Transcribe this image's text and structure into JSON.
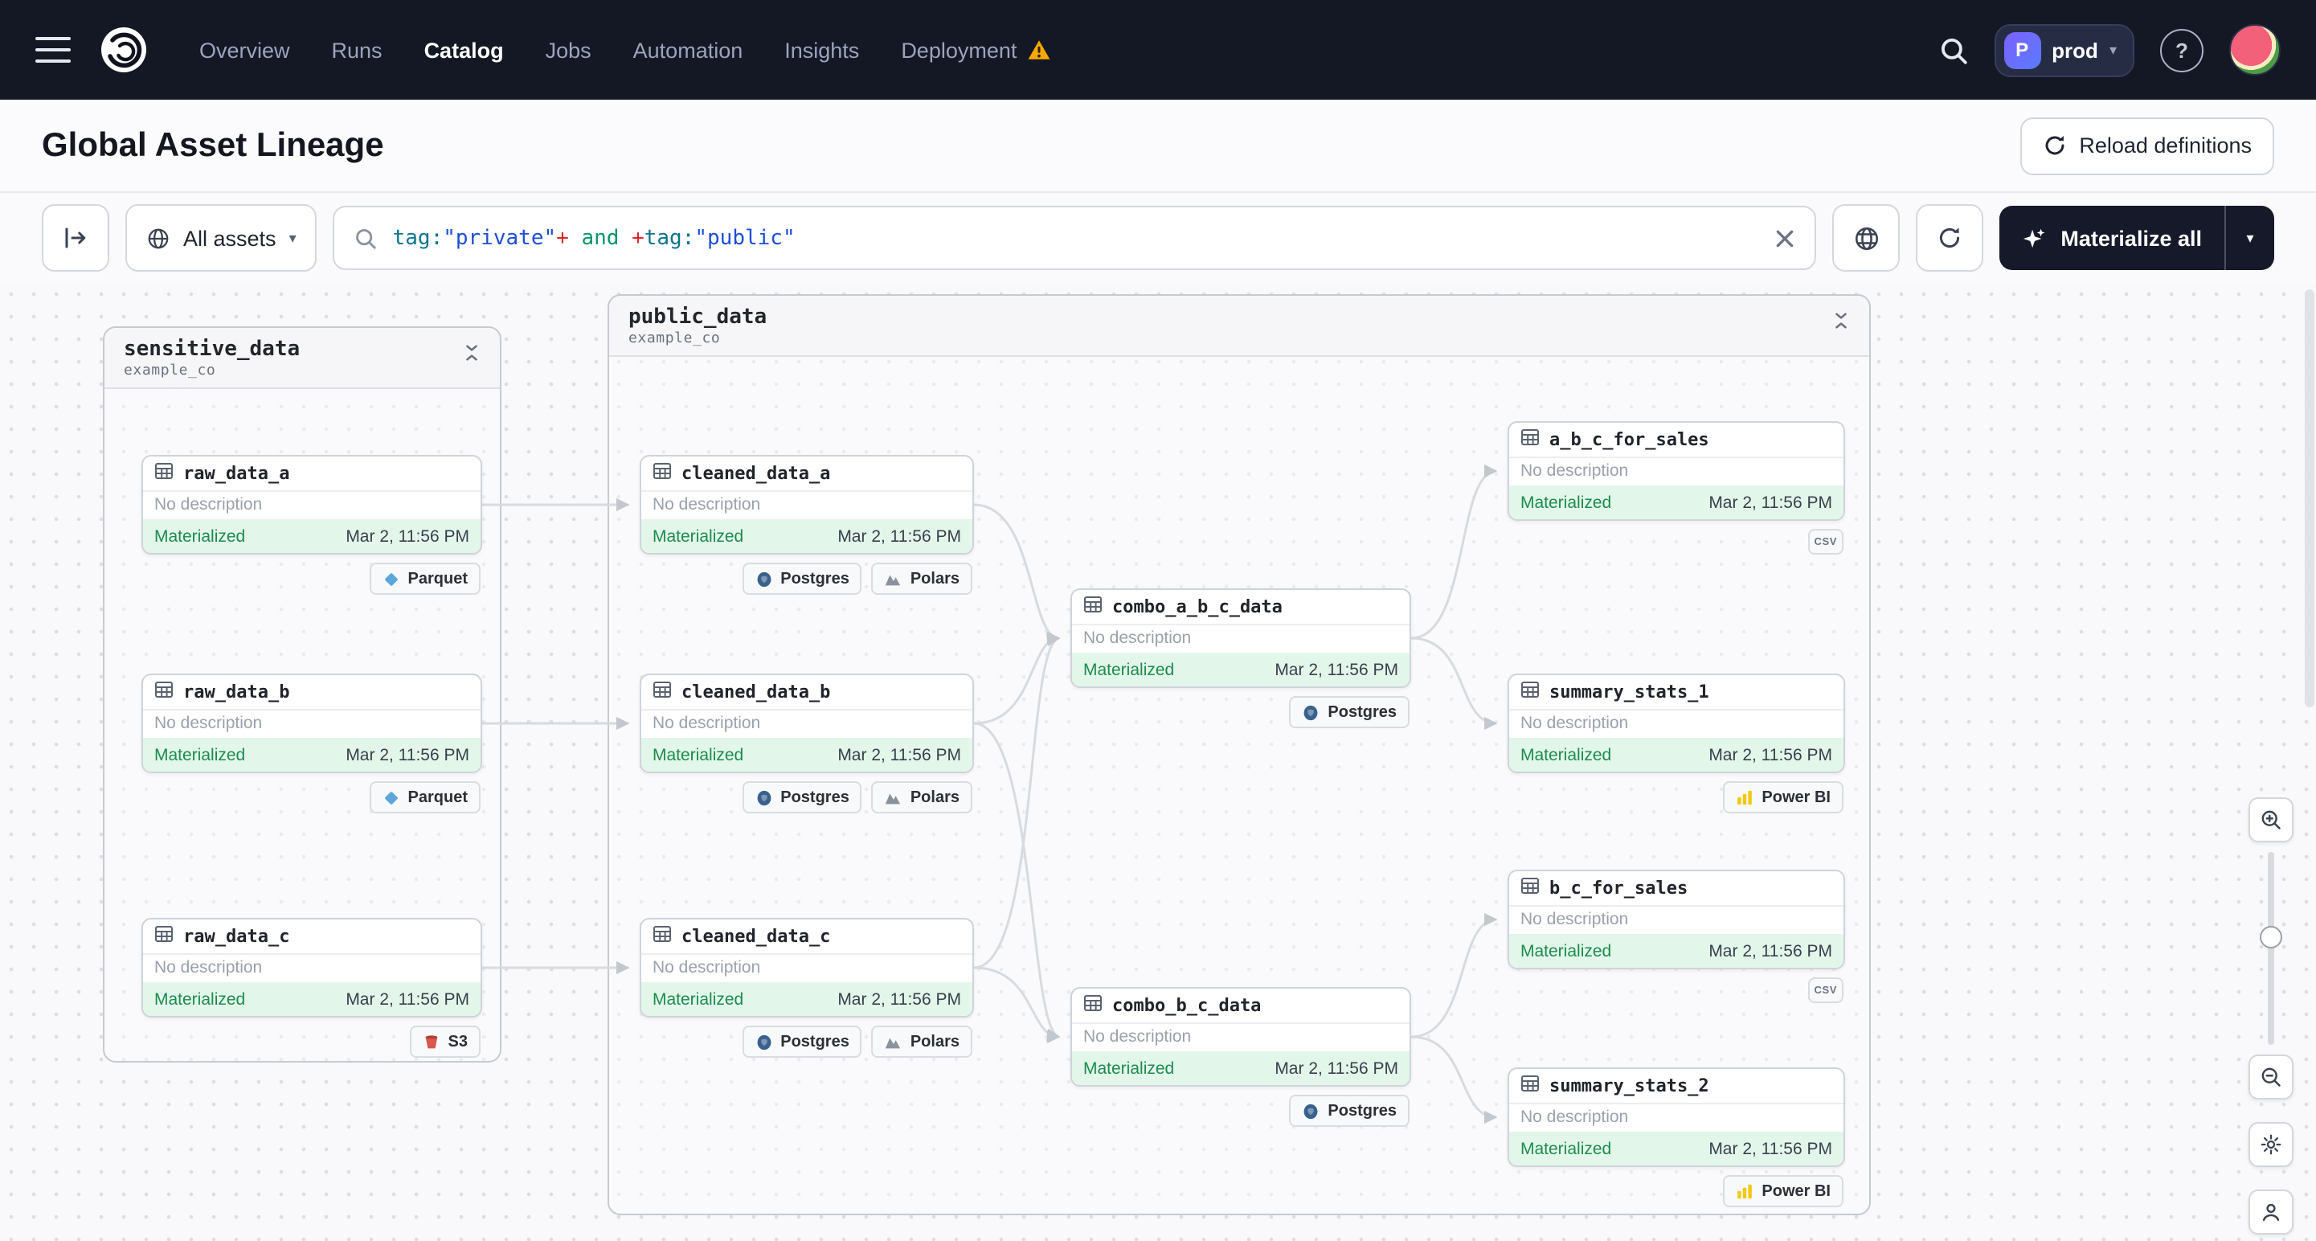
{
  "navbar": {
    "items": [
      "Overview",
      "Runs",
      "Catalog",
      "Jobs",
      "Automation",
      "Insights",
      "Deployment"
    ],
    "active_item": "Catalog",
    "env_badge_letter": "P",
    "env_name": "prod",
    "help_glyph": "?"
  },
  "header": {
    "title": "Global Asset Lineage",
    "reload_button": "Reload definitions"
  },
  "toolbar": {
    "scope_button": "All assets",
    "materialize_button": "Materialize all",
    "query_tokens": [
      {
        "text": "tag:",
        "style": "color:#0e7490"
      },
      {
        "text": "\"private\"",
        "style": "color:#1d4ed8"
      },
      {
        "text": "+",
        "style": "color:#dc2626"
      },
      {
        "text": " and ",
        "style": "color:#059669"
      },
      {
        "text": "+",
        "style": "color:#dc2626"
      },
      {
        "text": "tag:",
        "style": "color:#0e7490"
      },
      {
        "text": "\"public\"",
        "style": "color:#1d4ed8"
      }
    ]
  },
  "icons": {
    "caret_down": "▾"
  },
  "groups": [
    {
      "name": "sensitive_data",
      "subtitle": "example_co"
    },
    {
      "name": "public_data",
      "subtitle": "example_co"
    }
  ],
  "nodes": [
    {
      "name": "raw_data_a",
      "description": "No description",
      "status": "Materialized",
      "timestamp": "Mar 2, 11:56 PM",
      "badges": [
        {
          "type": "parquet",
          "label": "Parquet"
        }
      ]
    },
    {
      "name": "raw_data_b",
      "description": "No description",
      "status": "Materialized",
      "timestamp": "Mar 2, 11:56 PM",
      "badges": [
        {
          "type": "parquet",
          "label": "Parquet"
        }
      ]
    },
    {
      "name": "raw_data_c",
      "description": "No description",
      "status": "Materialized",
      "timestamp": "Mar 2, 11:56 PM",
      "badges": [
        {
          "type": "s3",
          "label": "S3"
        }
      ]
    },
    {
      "name": "cleaned_data_a",
      "description": "No description",
      "status": "Materialized",
      "timestamp": "Mar 2, 11:56 PM",
      "badges": [
        {
          "type": "postgres",
          "label": "Postgres"
        },
        {
          "type": "polars",
          "label": "Polars"
        }
      ]
    },
    {
      "name": "cleaned_data_b",
      "description": "No description",
      "status": "Materialized",
      "timestamp": "Mar 2, 11:56 PM",
      "badges": [
        {
          "type": "postgres",
          "label": "Postgres"
        },
        {
          "type": "polars",
          "label": "Polars"
        }
      ]
    },
    {
      "name": "cleaned_data_c",
      "description": "No description",
      "status": "Materialized",
      "timestamp": "Mar 2, 11:56 PM",
      "badges": [
        {
          "type": "postgres",
          "label": "Postgres"
        },
        {
          "type": "polars",
          "label": "Polars"
        }
      ]
    },
    {
      "name": "combo_a_b_c_data",
      "description": "No description",
      "status": "Materialized",
      "timestamp": "Mar 2, 11:56 PM",
      "badges": [
        {
          "type": "postgres",
          "label": "Postgres"
        }
      ]
    },
    {
      "name": "combo_b_c_data",
      "description": "No description",
      "status": "Materialized",
      "timestamp": "Mar 2, 11:56 PM",
      "badges": [
        {
          "type": "postgres",
          "label": "Postgres"
        }
      ]
    },
    {
      "name": "a_b_c_for_sales",
      "description": "No description",
      "status": "Materialized",
      "timestamp": "Mar 2, 11:56 PM",
      "badges": [
        {
          "type": "csv",
          "label": "csv"
        }
      ]
    },
    {
      "name": "summary_stats_1",
      "description": "No description",
      "status": "Materialized",
      "timestamp": "Mar 2, 11:56 PM",
      "badges": [
        {
          "type": "powerbi",
          "label": "Power BI"
        }
      ]
    },
    {
      "name": "b_c_for_sales",
      "description": "No description",
      "status": "Materialized",
      "timestamp": "Mar 2, 11:56 PM",
      "badges": [
        {
          "type": "csv",
          "label": "csv"
        }
      ]
    },
    {
      "name": "summary_stats_2",
      "description": "No description",
      "status": "Materialized",
      "timestamp": "Mar 2, 11:56 PM",
      "badges": [
        {
          "type": "powerbi",
          "label": "Power BI"
        }
      ]
    }
  ],
  "colors": {
    "navbar_bg": "#141824",
    "status_green_bg": "#E3F6EA",
    "status_green_text": "#1C8C4E",
    "warning": "#F7A800",
    "materialize_bg": "#151929",
    "edge": "#D7DADF"
  }
}
